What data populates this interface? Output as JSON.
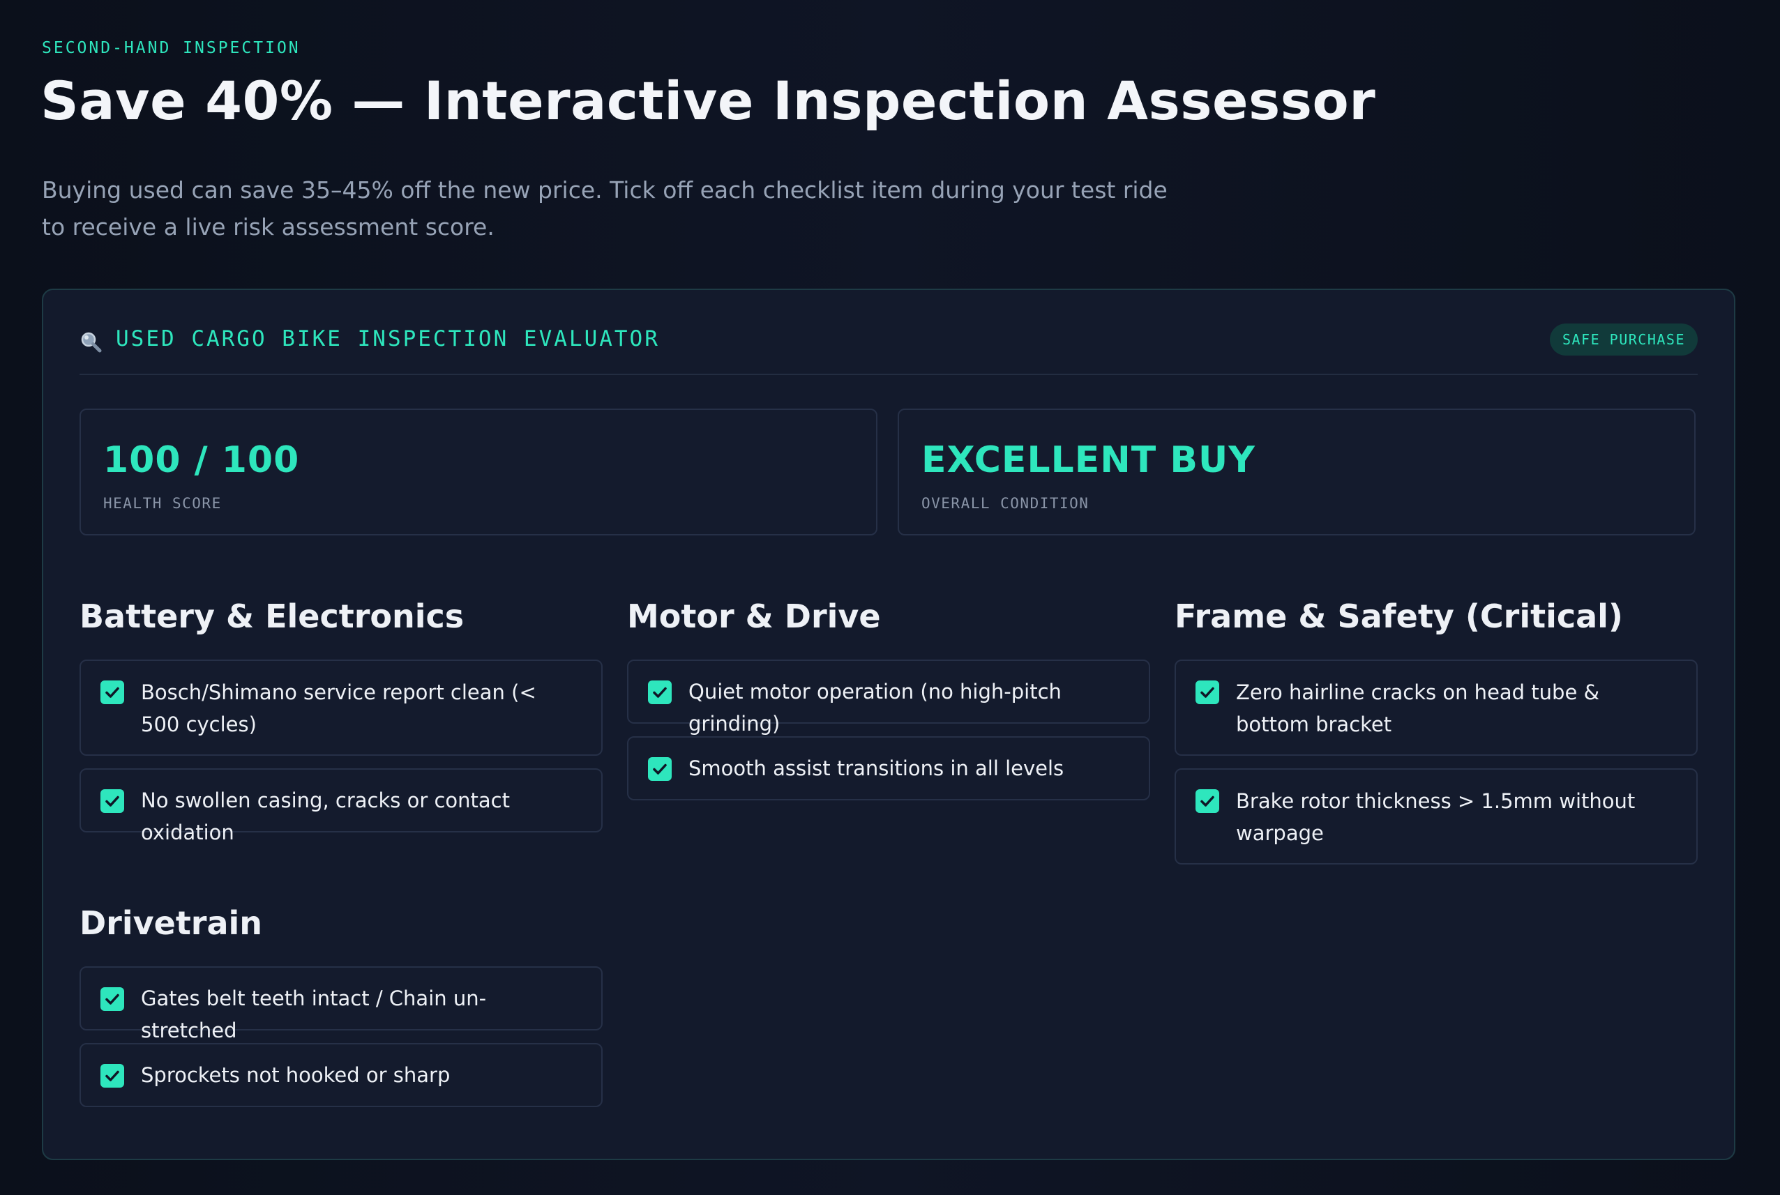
{
  "header": {
    "eyebrow": "SECOND-HAND INSPECTION",
    "title": "Save 40% — Interactive Inspection Assessor",
    "subtitle": "Buying used can save 35–45% off the new price. Tick off each checklist item during your test ride to receive a live risk assessment score."
  },
  "evaluator": {
    "title": "USED CARGO BIKE INSPECTION EVALUATOR",
    "icon": "magnifier-icon",
    "badge": "SAFE PURCHASE",
    "stats": [
      {
        "value": "100 / 100",
        "label": "HEALTH SCORE"
      },
      {
        "value": "EXCELLENT BUY",
        "label": "OVERALL CONDITION"
      }
    ],
    "sections": [
      {
        "title": "Battery & Electronics",
        "items": [
          {
            "label": "Bosch/Shimano service report clean (< 500 cycles)",
            "checked": true
          },
          {
            "label": "No swollen casing, cracks or contact oxidation",
            "checked": true
          }
        ]
      },
      {
        "title": "Motor & Drive",
        "items": [
          {
            "label": "Quiet motor operation (no high-pitch grinding)",
            "checked": true
          },
          {
            "label": "Smooth assist transitions in all levels",
            "checked": true
          }
        ]
      },
      {
        "title": "Frame & Safety (Critical)",
        "items": [
          {
            "label": "Zero hairline cracks on head tube & bottom bracket",
            "checked": true
          },
          {
            "label": "Brake rotor thickness > 1.5mm without warpage",
            "checked": true
          }
        ]
      },
      {
        "title": "Drivetrain",
        "items": [
          {
            "label": "Gates belt teeth intact / Chain un-stretched",
            "checked": true
          },
          {
            "label": "Sprockets not hooked or sharp",
            "checked": true
          }
        ]
      }
    ]
  },
  "colors": {
    "accent": "#2ee6bd",
    "background": "#0c111d",
    "card": "#131a2c",
    "border": "#263047",
    "muted": "#97a3b6"
  }
}
